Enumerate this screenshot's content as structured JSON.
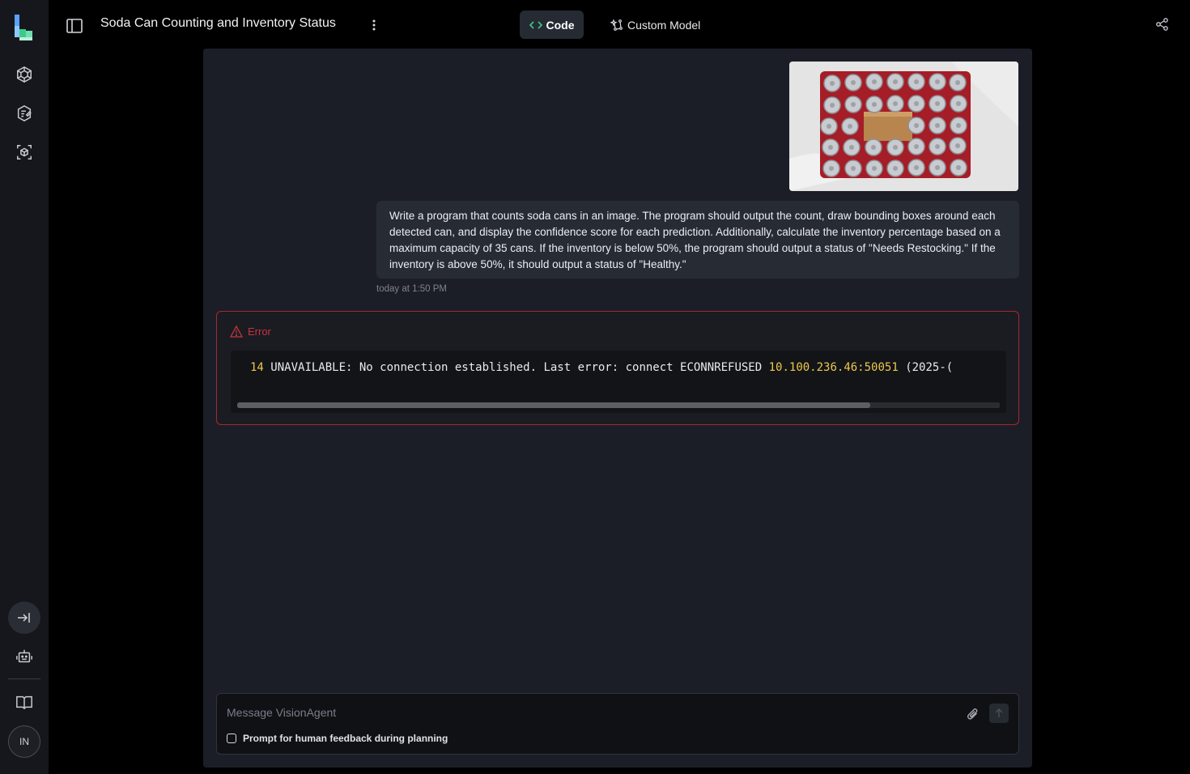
{
  "header": {
    "title": "Soda Can Counting and Inventory Status",
    "code_tab": "Code",
    "model_tab": "Custom Model"
  },
  "chat": {
    "user_message": "Write a program that counts soda cans in an image. The program should output the count, draw bounding boxes around each detected can, and display the confidence score for each prediction. Additionally, calculate the inventory percentage based on a maximum capacity of 35 cans. If the inventory is below 50%, the program should output a status of \"Needs Restocking.\" If the inventory is above 50%, it should output a status of \"Healthy.\"",
    "timestamp": "today at 1:50 PM"
  },
  "error": {
    "title": "Error",
    "code": "14",
    "message": "UNAVAILABLE: No connection established. Last error: connect ECONNREFUSED",
    "address": "10.100.236.46:50051",
    "trailing": "(2025-("
  },
  "composer": {
    "placeholder": "Message VisionAgent",
    "feedback_label": "Prompt for human feedback during planning"
  },
  "user": {
    "initials": "IN"
  },
  "colors": {
    "accent_green": "#3ec98b",
    "error_red": "#c7343c",
    "code_yellow": "#ecc94b"
  }
}
